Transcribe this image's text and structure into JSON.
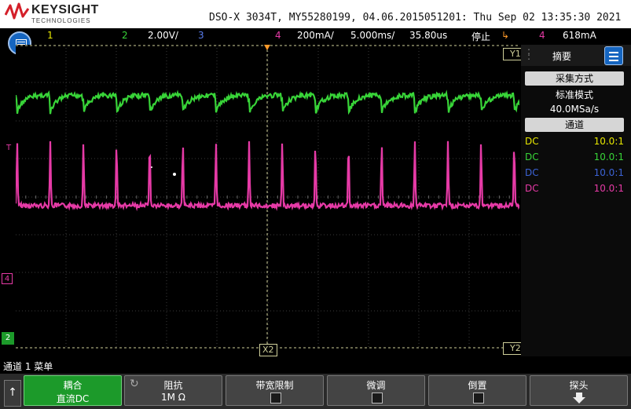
{
  "header": {
    "brand": "KEYSIGHT",
    "brand_sub": "TECHNOLOGIES",
    "title": "DSO-X 3034T, MY55280199, 04.06.2015051201: Thu Sep 02 13:35:30 2021"
  },
  "channel_bar": {
    "ch1_label": "1",
    "ch2_label": "2",
    "ch2_scale": "2.00V/",
    "ch3_label": "3",
    "ch4_label": "4",
    "ch4_scale": "200mA/",
    "timebase": "5.000ms/",
    "delay": "35.80us",
    "run_state": "停止",
    "trig_channel": "4",
    "trig_level": "618mA"
  },
  "markers": {
    "y1": "Y1",
    "y2": "Y2",
    "x2": "X2",
    "trig": "T",
    "ch4_ground": "4",
    "ch2_ground": "2"
  },
  "sidebar": {
    "title": "摘要",
    "acq_button": "采集方式",
    "acq_mode": "标准模式",
    "sample_rate": "40.0MSa/s",
    "channel_button": "通道",
    "channels": [
      {
        "coupling": "DC",
        "probe": "10.0:1",
        "color": "#e8e800"
      },
      {
        "coupling": "DC",
        "probe": "10.0:1",
        "color": "#38d438"
      },
      {
        "coupling": "DC",
        "probe": "10.0:1",
        "color": "#3c63d6"
      },
      {
        "coupling": "DC",
        "probe": "10.0:1",
        "color": "#e63aa6"
      }
    ]
  },
  "status": {
    "text": "通道 1 菜单"
  },
  "softkeys": [
    {
      "label": "耦合",
      "value": "直流DC"
    },
    {
      "label": "阻抗",
      "value": "1M Ω"
    },
    {
      "label": "带宽限制",
      "value": ""
    },
    {
      "label": "微调",
      "value": ""
    },
    {
      "label": "倒置",
      "value": ""
    },
    {
      "label": "探头",
      "value": ""
    }
  ],
  "colors": {
    "ch1": "#e8e800",
    "ch2": "#38d438",
    "ch3": "#3c63d6",
    "ch4": "#e63aa6",
    "accent": "#1565c0",
    "trigger_marker": "#ff9a2a"
  }
}
